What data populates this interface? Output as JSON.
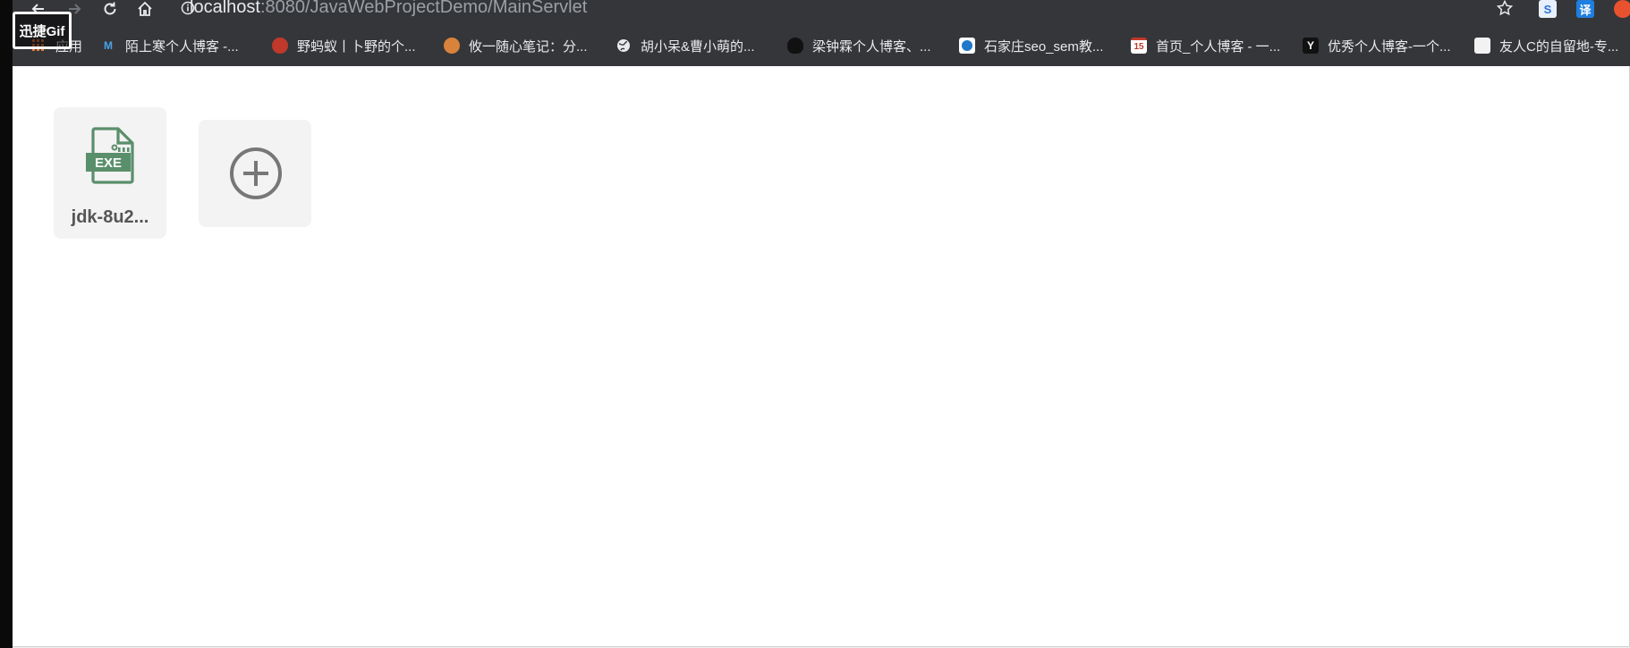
{
  "browser": {
    "url_host": "localhost",
    "url_path": ":8080/JavaWebProjectDemo/MainServlet",
    "right_icons": {
      "sogou_letter": "S",
      "translate_letter": "译"
    }
  },
  "bookmarks": [
    {
      "label": "应用",
      "icon": "apps-grid-icon"
    },
    {
      "label": "陌上寒个人博客 -...",
      "icon": "m-logo-icon"
    },
    {
      "label": "野蚂蚁丨卜野的个...",
      "icon": "red-logo-icon"
    },
    {
      "label": "攸一随心笔记：分...",
      "icon": "avatar-icon"
    },
    {
      "label": "胡小呆&曹小萌的...",
      "icon": "globe-icon"
    },
    {
      "label": "梁钟霖个人博客、...",
      "icon": "money-bag-icon"
    },
    {
      "label": "石家庄seo_sem教...",
      "icon": "blue-globe-icon"
    },
    {
      "label": "首页_个人博客 - 一...",
      "icon": "calendar-15-icon"
    },
    {
      "label": "优秀个人博客-一个...",
      "icon": "y-logo-icon"
    },
    {
      "label": "友人C的自留地-专...",
      "icon": "doc-icon"
    }
  ],
  "bookmark_glyphs": {
    "calendar_day": "15",
    "y_letter": "Y"
  },
  "watermark": "迅捷Gif",
  "files": [
    {
      "name": "jdk-8u2...",
      "type_label": "EXE"
    }
  ],
  "colors": {
    "exe_green": "#5a8f6b",
    "plus_gray": "#777777",
    "chrome_bg": "#35363a"
  }
}
